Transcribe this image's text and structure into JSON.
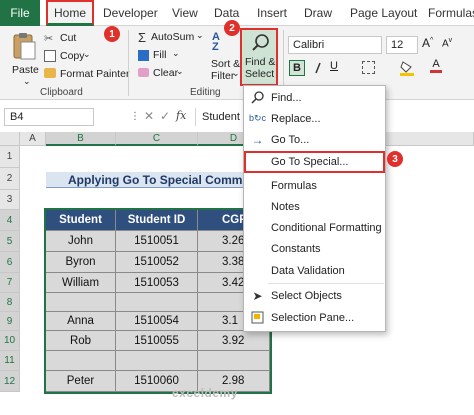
{
  "tabs": {
    "file": "File",
    "home": "Home",
    "others": [
      "Developer",
      "View",
      "Data",
      "Insert",
      "Draw",
      "Page Layout",
      "Formulas"
    ]
  },
  "ribbon": {
    "clipboard": {
      "paste": "Paste",
      "cut": "Cut",
      "copy": "Copy",
      "format_painter": "Format Painter",
      "group": "Clipboard"
    },
    "editing": {
      "autosum": "AutoSum",
      "fill": "Fill",
      "clear": "Clear",
      "sort_filter_1": "Sort &",
      "sort_filter_2": "Filter",
      "find_select_1": "Find &",
      "find_select_2": "Select",
      "group": "Editing"
    },
    "font": {
      "name": "Calibri",
      "size": "12",
      "bold": "B"
    }
  },
  "formula_bar": {
    "name_box": "B4",
    "fx": "fx",
    "content": "Student"
  },
  "grid": {
    "columns": [
      "A",
      "B",
      "C",
      "D"
    ],
    "rows": [
      "1",
      "2",
      "3",
      "4",
      "5",
      "6",
      "7",
      "8",
      "9",
      "10",
      "11",
      "12"
    ],
    "title": "Applying Go To Special Comman",
    "table": {
      "headers": [
        "Student",
        "Student ID",
        "CGP"
      ],
      "rows": [
        [
          "John",
          "1510051",
          "3.26"
        ],
        [
          "Byron",
          "1510052",
          "3.38"
        ],
        [
          "William",
          "1510053",
          "3.42"
        ],
        [
          "",
          "",
          ""
        ],
        [
          "Anna",
          "1510054",
          "3.1"
        ],
        [
          "Rob",
          "1510055",
          "3.92"
        ],
        [
          "",
          "",
          ""
        ],
        [
          "Peter",
          "1510060",
          "2.98"
        ]
      ]
    }
  },
  "menu": {
    "items": [
      "Find...",
      "Replace...",
      "Go To...",
      "Go To Special...",
      "Formulas",
      "Notes",
      "Conditional Formatting",
      "Constants",
      "Data Validation",
      "Select Objects",
      "Selection Pane..."
    ]
  },
  "badges": [
    "1",
    "2",
    "3"
  ],
  "watermark": "exceldemy",
  "colors": {
    "accent": "#217346",
    "highlight": "#e0302c",
    "table_header": "#2f4f7f"
  }
}
